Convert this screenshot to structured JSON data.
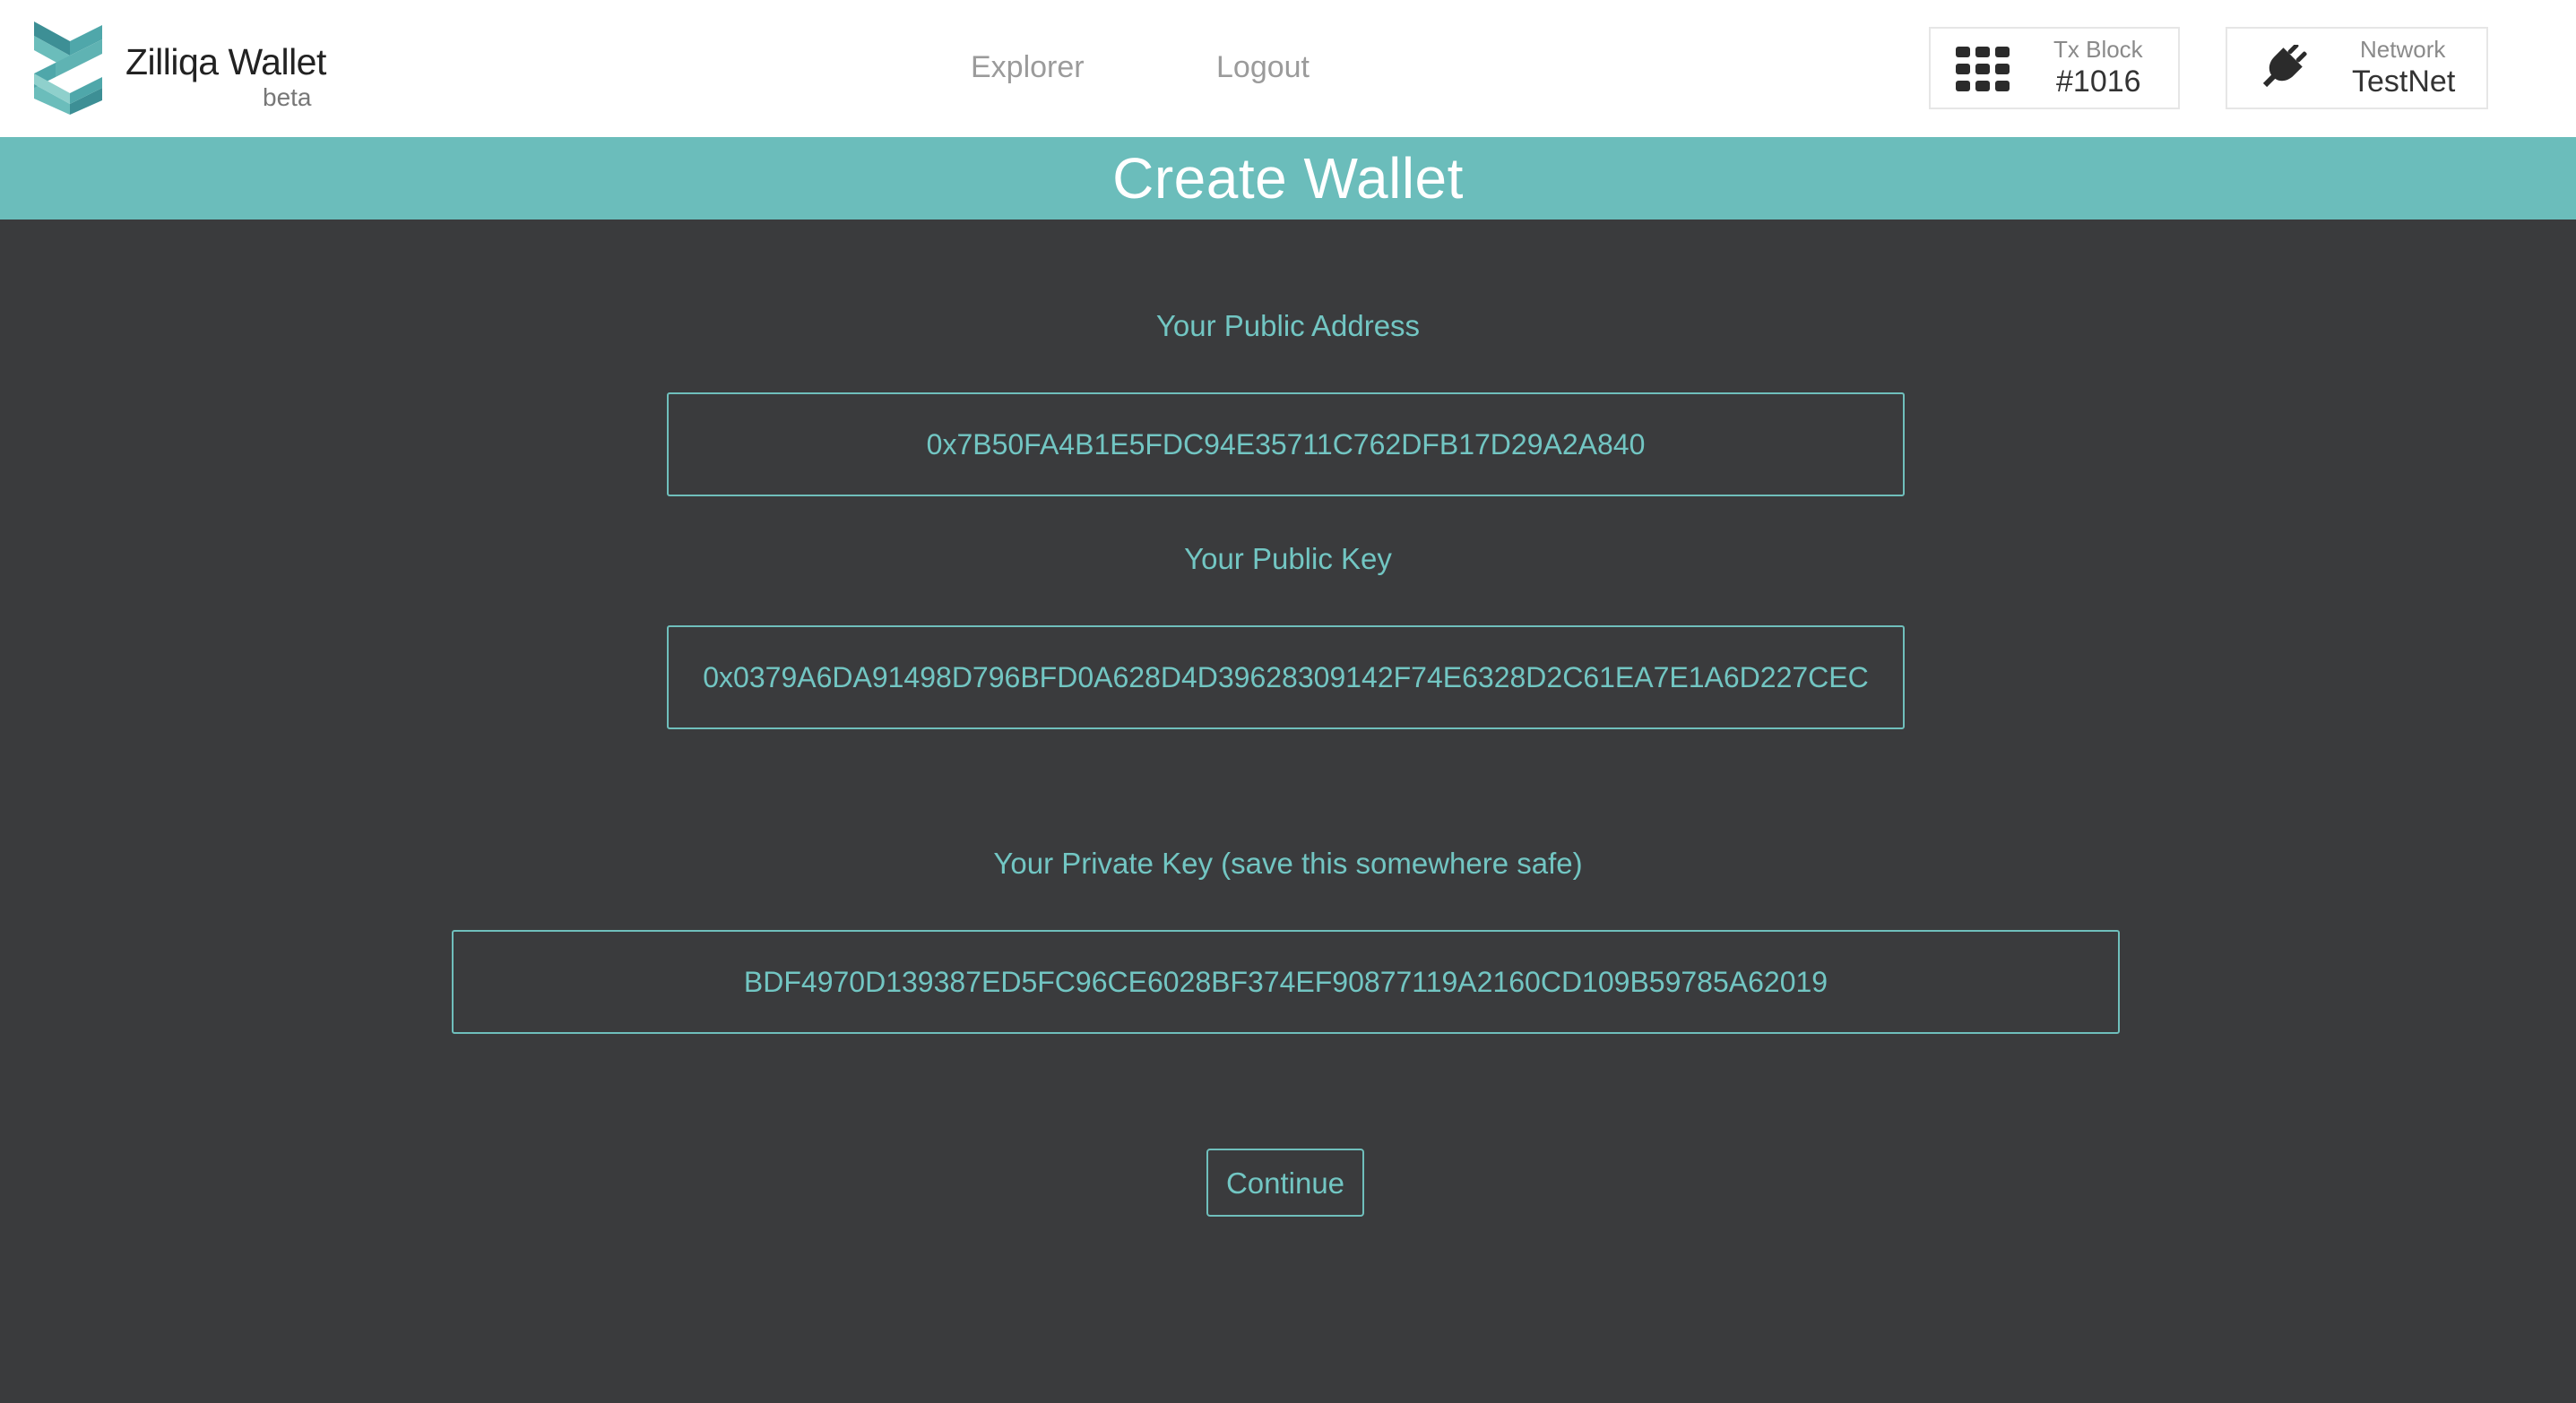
{
  "header": {
    "brand": "Zilliqa Wallet",
    "brand_sub": "beta",
    "nav": {
      "explorer": "Explorer",
      "logout": "Logout"
    },
    "tx_block": {
      "label": "Tx Block",
      "value": "#1016",
      "icon": "grid-icon"
    },
    "network": {
      "label": "Network",
      "value": "TestNet",
      "icon": "plug-icon"
    }
  },
  "banner": {
    "title": "Create Wallet"
  },
  "fields": {
    "public_address": {
      "label": "Your Public Address",
      "value": "0x7B50FA4B1E5FDC94E35711C762DFB17D29A2A840"
    },
    "public_key": {
      "label": "Your Public Key",
      "value": "0x0379A6DA91498D796BFD0A628D4D39628309142F74E6328D2C61EA7E1A6D227CEC"
    },
    "private_key": {
      "label": "Your Private Key (save this somewhere safe)",
      "value": "BDF4970D139387ED5FC96CE6028BF374EF90877119A2160CD109B59785A62019"
    }
  },
  "actions": {
    "continue_label": "Continue"
  },
  "colors": {
    "accent": "#6bbdbb",
    "background": "#3a3b3d",
    "header_bg": "#ffffff",
    "text_accent": "#72c6c3"
  }
}
